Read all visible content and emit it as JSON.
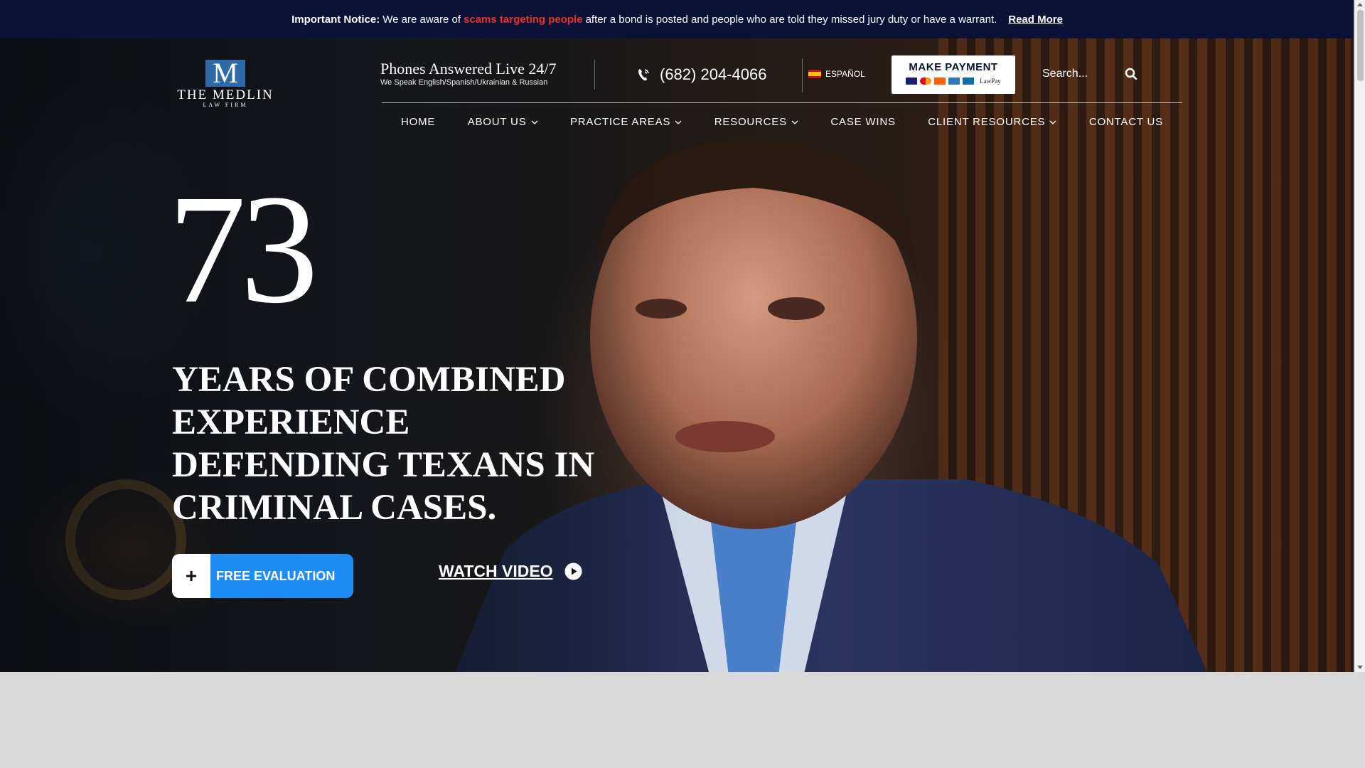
{
  "notice": {
    "label": "Important Notice:",
    "text_before": "We are aware of",
    "highlight": "scams targeting people",
    "text_after": "after a bond is posted and people who are told they missed jury duty or have a warrant.",
    "read_more": "Read More",
    "highlight_color": "#e8322b",
    "bg_color": "#0b1236"
  },
  "header": {
    "logo": {
      "mark": "M",
      "name": "THE MEDLIN",
      "sub": "LAW FIRM"
    },
    "phones_live": {
      "title": "Phones Answered Live 24/7",
      "subtitle": "We Speak English/Spanish/Ukrainian & Russian"
    },
    "phone": {
      "icon": "phone-icon",
      "number": "(682) 204-4066"
    },
    "language": {
      "icon": "spain-flag-icon",
      "label": "ESPAÑOL"
    },
    "payment": {
      "label": "MAKE PAYMENT",
      "brand": "LawPay"
    },
    "search": {
      "placeholder": "Search...",
      "icon": "search-icon"
    }
  },
  "nav": {
    "items": [
      {
        "label": "HOME"
      },
      {
        "label": "ABOUT US"
      },
      {
        "label": "PRACTICE AREAS"
      },
      {
        "label": "RESOURCES"
      },
      {
        "label": "CASE WINS"
      },
      {
        "label": "CLIENT RESOURCES"
      },
      {
        "label": "CONTACT US"
      }
    ]
  },
  "hero": {
    "big_number": "73",
    "headline": "Years of Combined Experience Defending Texans in Criminal Cases.",
    "cta_label": "FREE EVALUATION",
    "cta_icon": "plus-icon",
    "watch_label": "WATCH VIDEO",
    "watch_icon": "play-icon",
    "accent_color": "#1e8cf5"
  }
}
